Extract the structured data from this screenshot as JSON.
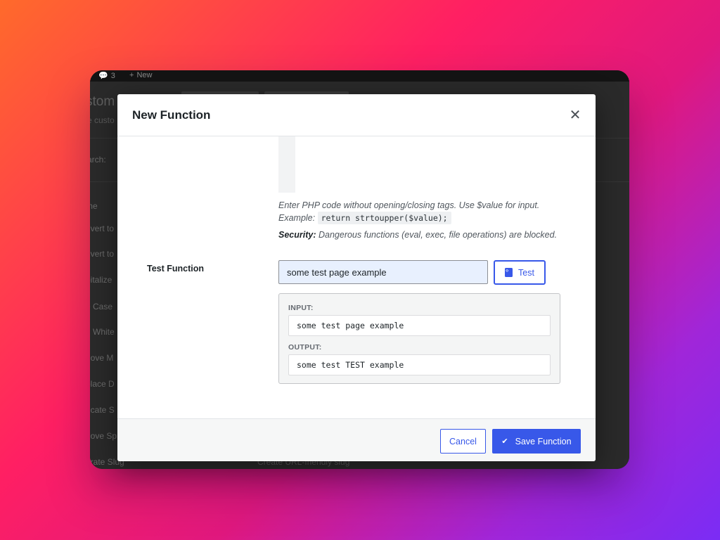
{
  "background_app": {
    "admin_bar": {
      "comment_count": "3",
      "new_label": "New"
    },
    "title_fragment": "stom",
    "subtitle_fragment": "e custo",
    "search_fragment": "arch:",
    "column_header": "me",
    "rows": [
      "nvert to",
      "nvert to",
      "pitalize",
      "e Case",
      "n White",
      "nove M",
      "place D",
      "ncate S",
      "nove Sp",
      "erate Slug"
    ],
    "last_row_description": "Create URL-friendly slug"
  },
  "modal": {
    "title": "New Function",
    "close_icon": "close-icon",
    "help": {
      "line1": "Enter PHP code without opening/closing tags. Use $value for input.",
      "example_prefix": "Example:",
      "example_code": "return strtoupper($value);",
      "security_label": "Security:",
      "security_text": "Dangerous functions (eval, exec, file operations) are blocked."
    },
    "test": {
      "label": "Test Function",
      "input_value": "some test page example",
      "button_label": "Test",
      "button_icon": "code-file-icon"
    },
    "result": {
      "input_label": "INPUT:",
      "input_value": "some test page example",
      "output_label": "OUTPUT:",
      "output_value": "some test TEST example"
    },
    "footer": {
      "cancel_label": "Cancel",
      "save_label": "Save Function",
      "save_icon": "checkmark-icon"
    }
  },
  "colors": {
    "accent": "#3858e9",
    "autofill_bg": "#e8f0fe",
    "overlay": "#2a2a2a"
  }
}
